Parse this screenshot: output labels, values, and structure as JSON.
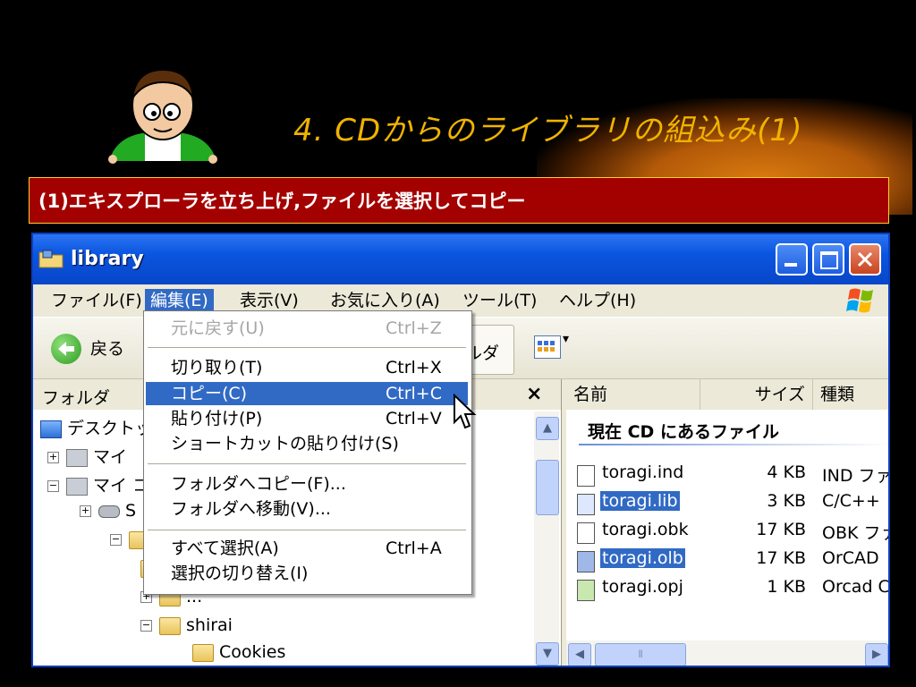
{
  "slide": {
    "title": "4. CDからのライブラリの組込み(1)",
    "subtitle": "(1)エキスプローラを立ち上げ,ファイルを選択してコピー"
  },
  "window": {
    "title": "library",
    "menu": [
      "ファイル(F)",
      "編集(E)",
      "表示(V)",
      "お気に入り(A)",
      "ツール(T)",
      "ヘルプ(H)"
    ],
    "toolbar": {
      "back_label": "戻る",
      "folders_label": "ルダ"
    }
  },
  "edit_menu": [
    {
      "label": "元に戻す(U)",
      "shortcut": "Ctrl+Z",
      "state": "disabled"
    },
    {
      "label": "切り取り(T)",
      "shortcut": "Ctrl+X",
      "state": "normal"
    },
    {
      "label": "コピー(C)",
      "shortcut": "Ctrl+C",
      "state": "highlighted"
    },
    {
      "label": "貼り付け(P)",
      "shortcut": "Ctrl+V",
      "state": "normal"
    },
    {
      "label": "ショートカットの貼り付け(S)",
      "shortcut": "",
      "state": "normal"
    },
    {
      "label": "フォルダへコピー(F)...",
      "shortcut": "",
      "state": "normal"
    },
    {
      "label": "フォルダへ移動(V)...",
      "shortcut": "",
      "state": "normal"
    },
    {
      "label": "すべて選択(A)",
      "shortcut": "Ctrl+A",
      "state": "normal"
    },
    {
      "label": "選択の切り替え(I)",
      "shortcut": "",
      "state": "normal"
    }
  ],
  "folder_pane": {
    "title": "フォルダ",
    "close_glyph": "×",
    "tree": [
      {
        "label": "デスクトッ",
        "icon": "desktop-icon",
        "toggle": ""
      },
      {
        "label": "マイ",
        "icon": "my-documents-icon",
        "toggle": "+"
      },
      {
        "label": "マイ コ",
        "icon": "my-computer-icon",
        "toggle": "−"
      },
      {
        "label": "S",
        "icon": "drive-icon",
        "toggle": "+"
      },
      {
        "label": "",
        "icon": "folder-icon",
        "toggle": "−"
      },
      {
        "label": "",
        "icon": "folder-icon",
        "toggle": ""
      },
      {
        "label": "...",
        "icon": "folder-icon",
        "toggle": "+"
      },
      {
        "label": "shirai",
        "icon": "folder-icon",
        "toggle": "−"
      },
      {
        "label": "Cookies",
        "icon": "folder-icon",
        "toggle": ""
      }
    ]
  },
  "file_pane": {
    "columns": [
      "名前",
      "サイズ",
      "種類"
    ],
    "group_title": "現在 CD にあるファイル",
    "files": [
      {
        "name": "toragi.ind",
        "size": "4 KB",
        "type": "IND ファ",
        "selected": false
      },
      {
        "name": "toragi.lib",
        "size": "3 KB",
        "type": "C/C++",
        "selected": true
      },
      {
        "name": "toragi.obk",
        "size": "17 KB",
        "type": "OBK ファ",
        "selected": false
      },
      {
        "name": "toragi.olb",
        "size": "17 KB",
        "type": "OrCAD",
        "selected": true
      },
      {
        "name": "toragi.opj",
        "size": "1 KB",
        "type": "Orcad C",
        "selected": false
      }
    ]
  },
  "colors": {
    "title_text": "#f0b300",
    "subtitle_bar": "#a30000",
    "selection": "#316ac5",
    "xp_titlebar": "#0a55e0"
  }
}
